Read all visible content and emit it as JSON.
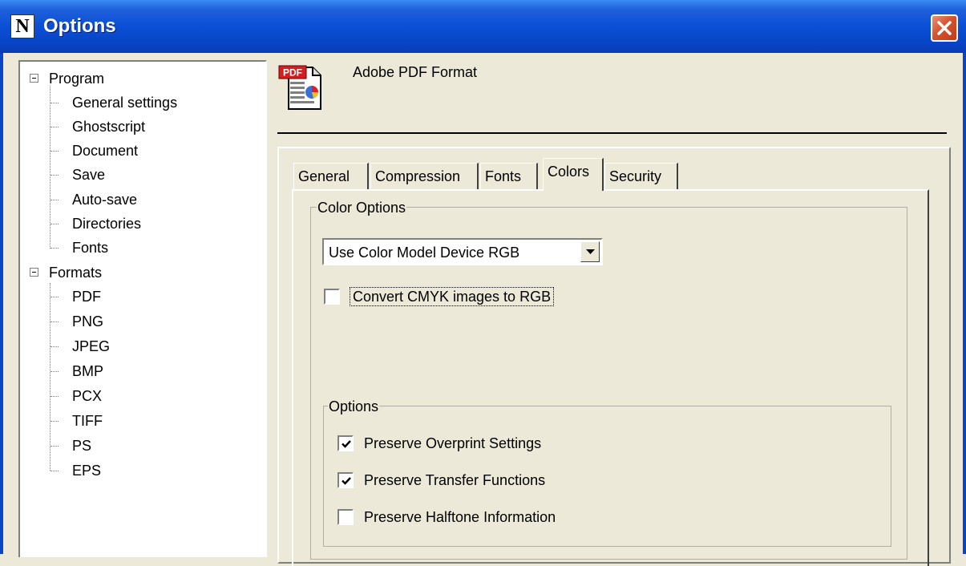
{
  "window": {
    "title": "Options",
    "app_icon_glyph": "N"
  },
  "tree": {
    "groups": [
      {
        "label": "Program",
        "children": [
          "General settings",
          "Ghostscript",
          "Document",
          "Save",
          "Auto-save",
          "Directories",
          "Fonts"
        ]
      },
      {
        "label": "Formats",
        "children": [
          "PDF",
          "PNG",
          "JPEG",
          "BMP",
          "PCX",
          "TIFF",
          "PS",
          "EPS"
        ]
      }
    ]
  },
  "header": {
    "format_title": "Adobe PDF Format",
    "icon": "pdf-file-icon",
    "icon_text": "PDF"
  },
  "tabs": {
    "items": [
      "General",
      "Compression",
      "Fonts",
      "Colors",
      "Security"
    ],
    "active": "Colors"
  },
  "color_options": {
    "legend": "Color Options",
    "color_model": {
      "value": "Use Color Model Device RGB"
    },
    "convert_cmyk": {
      "label": "Convert CMYK images to RGB",
      "checked": false
    }
  },
  "options": {
    "legend": "Options",
    "preserve_overprint": {
      "label": "Preserve Overprint Settings",
      "checked": true
    },
    "preserve_transfer": {
      "label": "Preserve Transfer Functions",
      "checked": true
    },
    "preserve_halftone": {
      "label": "Preserve Halftone Information",
      "checked": false
    }
  },
  "colors": {
    "titlebar": "#0A4FD6",
    "close_button": "#D5532E",
    "dialog_bg": "#ECE9D8"
  }
}
